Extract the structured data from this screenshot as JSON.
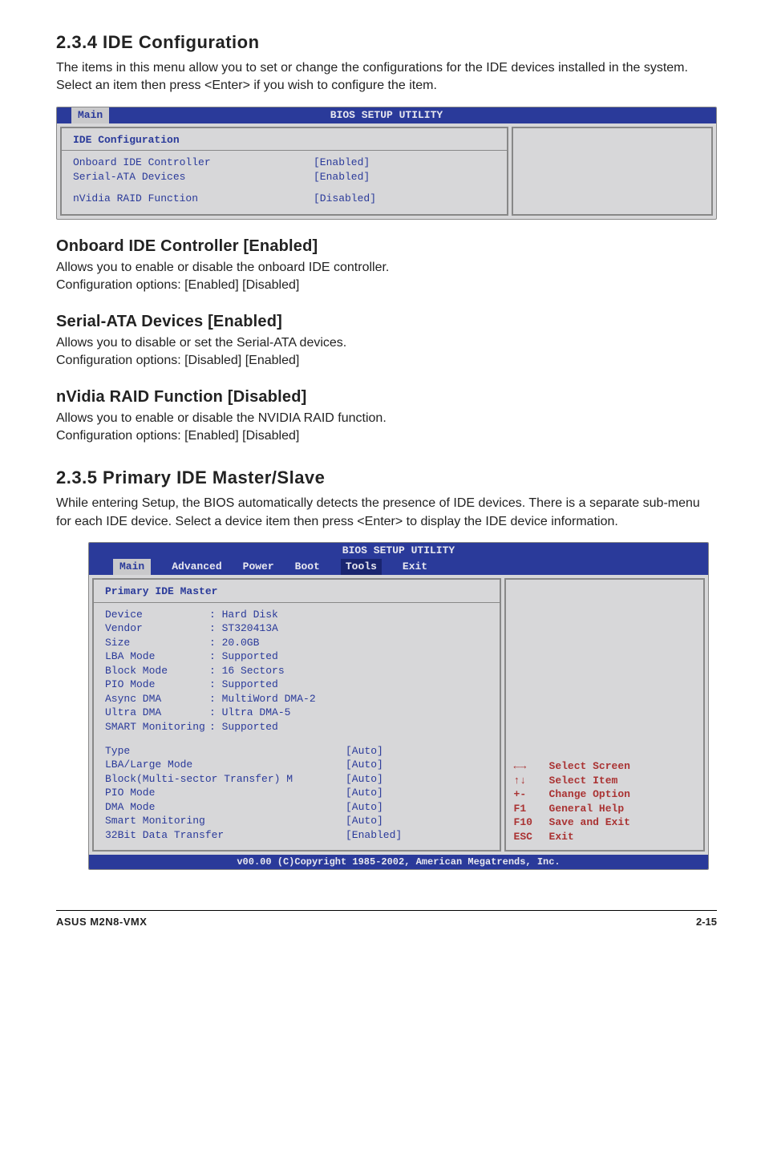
{
  "section1": {
    "heading": "2.3.4  IDE Configuration",
    "intro": "The items in this menu allow you to set or change the configurations for the IDE devices installed in the system. Select an item then press <Enter> if you wish to configure the item."
  },
  "bios1": {
    "title": "BIOS SETUP UTILITY",
    "tab": "Main",
    "panel_title": "IDE Configuration",
    "rows": [
      {
        "k": "Onboard IDE Controller",
        "v": "[Enabled]"
      },
      {
        "k": "Serial-ATA Devices",
        "v": "[Enabled]"
      }
    ],
    "rows2": [
      {
        "k": "nVidia RAID Function",
        "v": "[Disabled]"
      }
    ]
  },
  "subs": [
    {
      "h": "Onboard IDE Controller [Enabled]",
      "p1": "Allows you to enable or disable the onboard IDE controller.",
      "p2": "Configuration options: [Enabled] [Disabled]"
    },
    {
      "h": "Serial-ATA Devices [Enabled]",
      "p1": "Allows you to disable or set the Serial-ATA devices.",
      "p2": "Configuration options: [Disabled] [Enabled]"
    },
    {
      "h": "nVidia RAID Function [Disabled]",
      "p1": "Allows you to enable or disable the NVIDIA RAID function.",
      "p2": "Configuration options: [Enabled] [Disabled]"
    }
  ],
  "section2": {
    "heading": "2.3.5  Primary IDE Master/Slave",
    "intro": "While entering Setup, the BIOS automatically detects the presence of IDE devices. There is a separate sub-menu for each IDE device. Select a device item then press <Enter> to display the IDE device information."
  },
  "bios2": {
    "title": "BIOS SETUP UTILITY",
    "tabs": [
      "Main",
      "Advanced",
      "Power",
      "Boot",
      "Tools",
      "Exit"
    ],
    "panel_title": "Primary IDE Master",
    "info": [
      {
        "k": "Device",
        "v": ": Hard Disk"
      },
      {
        "k": "Vendor",
        "v": ": ST320413A"
      },
      {
        "k": "Size",
        "v": ": 20.0GB"
      },
      {
        "k": "LBA Mode",
        "v": ": Supported"
      },
      {
        "k": "Block Mode",
        "v": ": 16 Sectors"
      },
      {
        "k": "PIO Mode",
        "v": ": Supported"
      },
      {
        "k": "Async DMA",
        "v": ": MultiWord DMA-2"
      },
      {
        "k": "Ultra DMA",
        "v": ": Ultra DMA-5"
      },
      {
        "k": "SMART Monitoring",
        "v": ": Supported"
      }
    ],
    "settings": [
      {
        "k": "Type",
        "v": "[Auto]"
      },
      {
        "k": "LBA/Large Mode",
        "v": "[Auto]"
      },
      {
        "k": "Block(Multi-sector Transfer) M",
        "v": "[Auto]"
      },
      {
        "k": "PIO Mode",
        "v": "[Auto]"
      },
      {
        "k": "DMA Mode",
        "v": "[Auto]"
      },
      {
        "k": "Smart Monitoring",
        "v": "[Auto]"
      },
      {
        "k": "32Bit Data Transfer",
        "v": "[Enabled]"
      }
    ],
    "help": [
      {
        "k": "←→",
        "t": "Select Screen"
      },
      {
        "k": "↑↓",
        "t": "Select Item"
      },
      {
        "k": "+-",
        "t": "Change Option"
      },
      {
        "k": "F1",
        "t": "General Help"
      },
      {
        "k": "F10",
        "t": "Save and Exit"
      },
      {
        "k": "ESC",
        "t": "Exit"
      }
    ],
    "footer": "v00.00 (C)Copyright 1985-2002, American Megatrends, Inc."
  },
  "footer": {
    "left": "ASUS M2N8-VMX",
    "right": "2-15"
  }
}
